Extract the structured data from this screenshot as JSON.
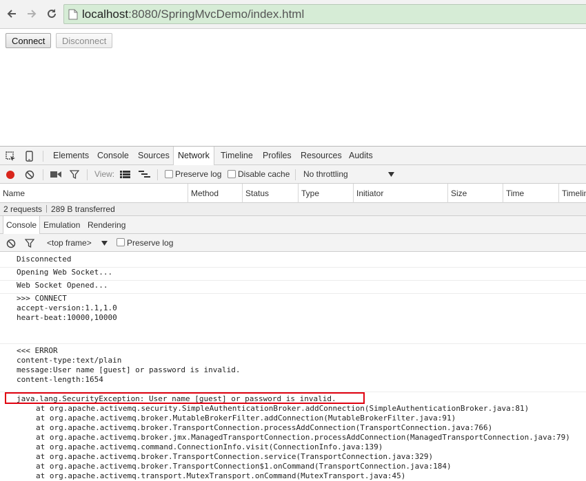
{
  "browser": {
    "url_host": "localhost",
    "url_rest": ":8080/SpringMvcDemo/index.html",
    "icons": [
      "back-icon",
      "forward-icon",
      "reload-icon",
      "page-icon"
    ]
  },
  "page": {
    "connect_label": "Connect",
    "disconnect_label": "Disconnect"
  },
  "devtools": {
    "tabs": [
      "Elements",
      "Console",
      "Sources",
      "Network",
      "Timeline",
      "Profiles",
      "Resources",
      "Audits"
    ],
    "active_tab": "Network",
    "network": {
      "view_label": "View:",
      "preserve_log_label": "Preserve log",
      "disable_cache_label": "Disable cache",
      "throttling_label": "No throttling",
      "columns": [
        "Name",
        "Method",
        "Status",
        "Type",
        "Initiator",
        "Size",
        "Time",
        "Timeline"
      ],
      "summary_requests": "2 requests",
      "summary_transferred": "289 B transferred"
    },
    "drawer": {
      "tabs": [
        "Console",
        "Emulation",
        "Rendering"
      ],
      "active_tab": "Console",
      "frame_label": "<top frame>",
      "preserve_log_label": "Preserve log"
    },
    "console": {
      "messages": [
        "Disconnected",
        "Opening Web Socket...",
        "Web Socket Opened...",
        ">>> CONNECT\naccept-version:1.1,1.0\nheart-beat:10000,10000\n\n",
        "<<< ERROR\ncontent-type:text/plain\nmessage:User name [guest] or password is invalid.\ncontent-length:1654\n"
      ],
      "exception": "java.lang.SecurityException: User name [guest] or password is invalid.",
      "stack": [
        "at org.apache.activemq.security.SimpleAuthenticationBroker.addConnection(SimpleAuthenticationBroker.java:81)",
        "at org.apache.activemq.broker.MutableBrokerFilter.addConnection(MutableBrokerFilter.java:91)",
        "at org.apache.activemq.broker.TransportConnection.processAddConnection(TransportConnection.java:766)",
        "at org.apache.activemq.broker.jmx.ManagedTransportConnection.processAddConnection(ManagedTransportConnection.java:79)",
        "at org.apache.activemq.command.ConnectionInfo.visit(ConnectionInfo.java:139)",
        "at org.apache.activemq.broker.TransportConnection.service(TransportConnection.java:329)",
        "at org.apache.activemq.broker.TransportConnection$1.onCommand(TransportConnection.java:184)",
        "at org.apache.activemq.transport.MutexTransport.onCommand(MutexTransport.java:45)"
      ],
      "highlight_color": "#e0000f"
    }
  }
}
